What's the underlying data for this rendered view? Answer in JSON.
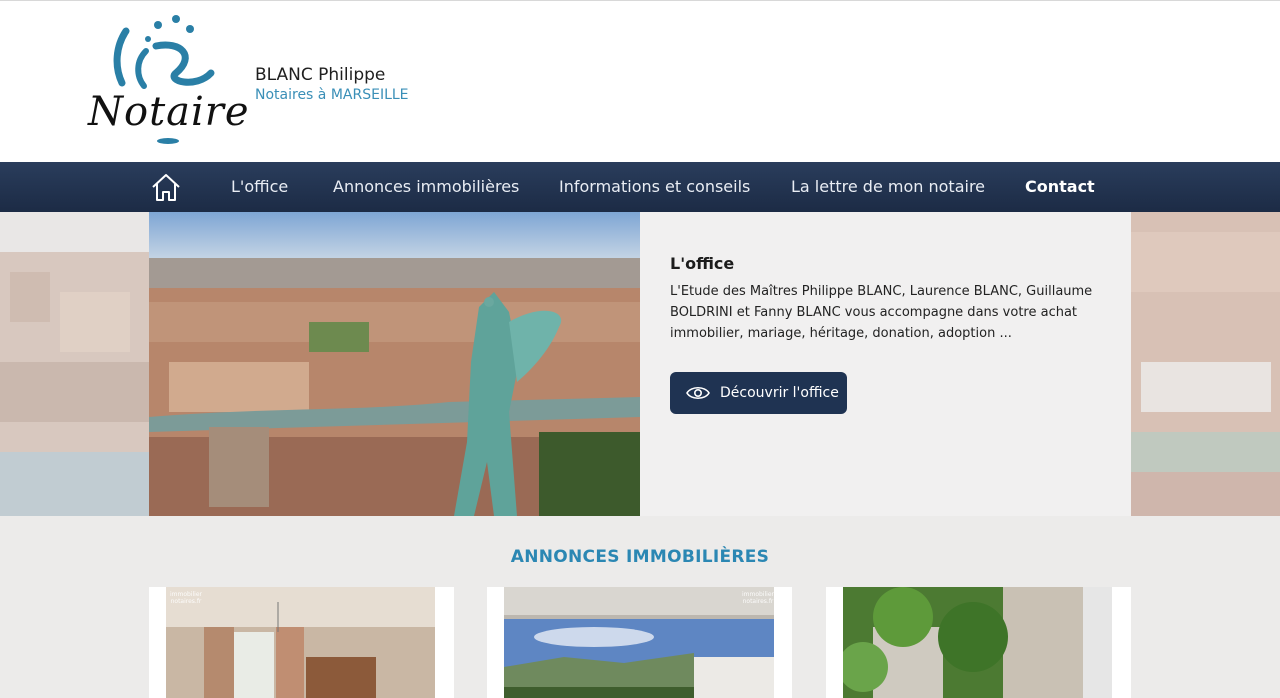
{
  "header": {
    "logo_text": "Notaire",
    "firm_name": "BLANC Philippe",
    "firm_subtitle": "Notaires à MARSEILLE"
  },
  "nav": {
    "home_icon": "home-icon",
    "items": [
      "L'office",
      "Annonces immobilières",
      "Informations et conseils",
      "La lettre de mon notaire",
      "Contact"
    ]
  },
  "hero": {
    "title": "L'office",
    "text": "L'Etude des Maîtres Philippe BLANC, Laurence BLANC, Guillaume BOLDRINI et Fanny BLANC vous accompagne dans votre achat immobilier, mariage, héritage, donation, adoption ...",
    "button_label": "Découvrir l'office",
    "button_icon": "eye-icon"
  },
  "listings": {
    "title": "ANNONCES IMMOBILIÈRES",
    "watermark_line1": "immobilier",
    "watermark_line2": "notaires.fr"
  },
  "colors": {
    "nav_bg": "#1c2b45",
    "accent": "#2b87b3",
    "button_bg": "#1f3352"
  }
}
